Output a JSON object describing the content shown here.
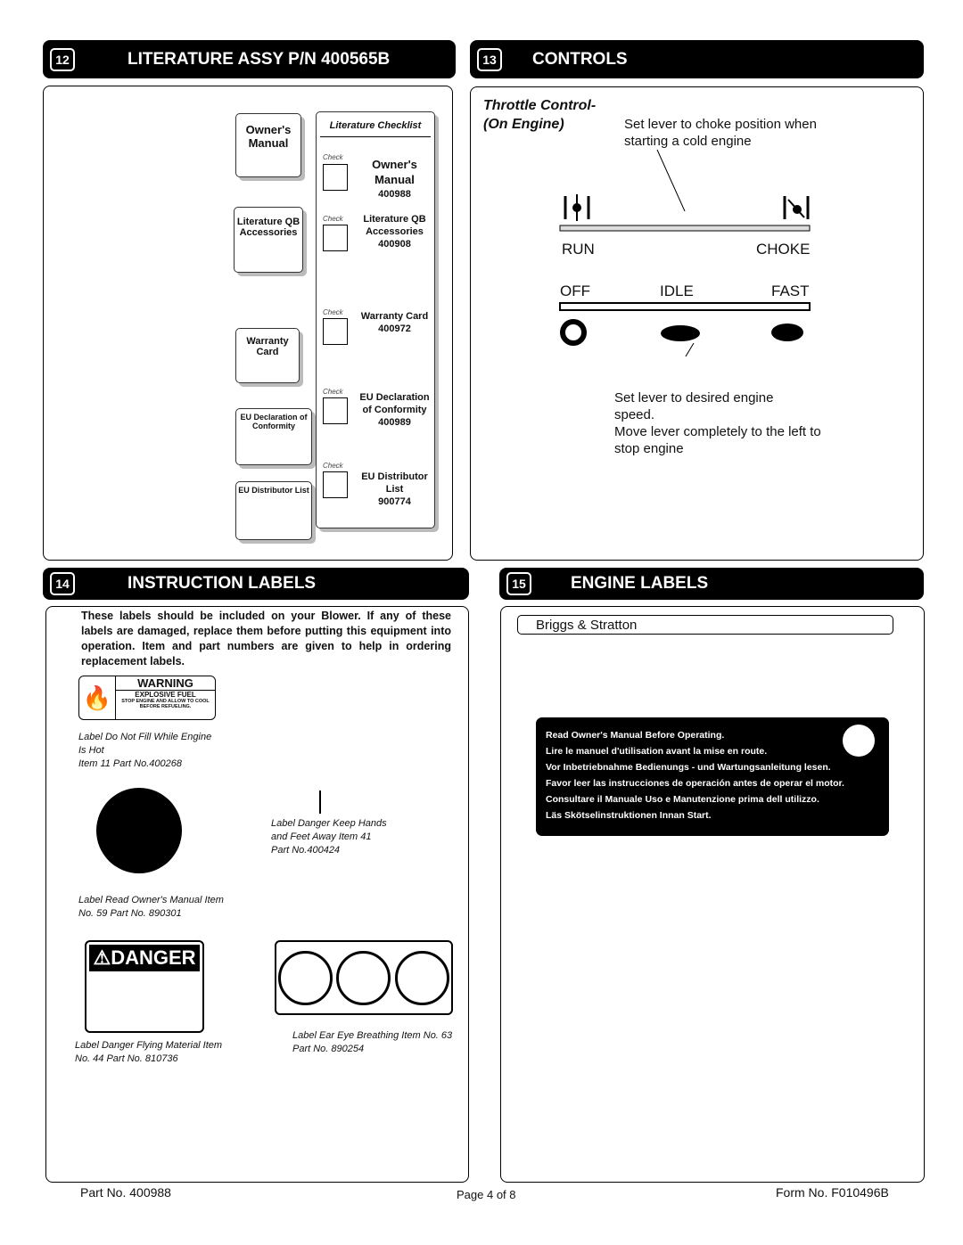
{
  "sections": {
    "s12": {
      "num": "12",
      "title": "LITERATURE ASSY  P/N  400565B"
    },
    "s13": {
      "num": "13",
      "title": "CONTROLS"
    },
    "s14": {
      "num": "14",
      "title": "INSTRUCTION  LABELS"
    },
    "s15": {
      "num": "15",
      "title": "ENGINE  LABELS"
    }
  },
  "literature": {
    "cards": [
      "Owner's Manual",
      "Literature QB Accessories",
      "Warranty Card",
      "EU Declaration of Conformity",
      "EU Distributor List"
    ],
    "checklist_title": "Literature Checklist",
    "check_label": "Check",
    "items": [
      {
        "name": "Owner's Manual",
        "part": "400988"
      },
      {
        "name": "Literature QB Accessories",
        "part": "400908"
      },
      {
        "name": "Warranty Card",
        "part": "400972"
      },
      {
        "name": "EU Declaration of Conformity",
        "part": "400989"
      },
      {
        "name": "EU Distributor List",
        "part": "900774"
      }
    ]
  },
  "controls": {
    "heading": "Throttle Control- (On Engine)",
    "choke_note": "Set lever to choke position when starting a cold engine",
    "run": "RUN",
    "choke": "CHOKE",
    "off": "OFF",
    "idle": "IDLE",
    "fast": "FAST",
    "speed_note": "Set lever to desired engine speed.",
    "stop_note": "Move lever completely to the left to stop engine"
  },
  "instructions": {
    "intro": "These labels should be included on your Blower.  If any of these labels are damaged, replace them before putting this equipment into operation. Item and part numbers are given to help in ordering replacement labels.",
    "warning": {
      "title": "WARNING",
      "sub": "EXPLOSIVE FUEL",
      "text": "STOP ENGINE AND ALLOW TO COOL BEFORE REFUELING.",
      "caption": "Label Do Not Fill While Engine Is Hot\nItem 11  Part No.400268"
    },
    "danger_keep_caption": "Label Danger Keep Hands and Feet Away Item 41 Part No.400424",
    "read_manual_caption": "Label Read Owner's Manual Item No. 59  Part No. 890301",
    "danger": {
      "title": "DANGER",
      "caption": "Label Danger Flying Material Item No. 44  Part No. 810736"
    },
    "ear_eye_caption": "Label Ear Eye Breathing Item No. 63 Part No. 890254"
  },
  "engine": {
    "field": "Briggs & Stratton",
    "label_lines": [
      "Read Owner's Manual Before Operating.",
      "Lire le manuel d'utilisation avant la mise en route.",
      "Vor Inbetriebnahme Bedienungs - und Wartungsanleitung lesen.",
      "Favor leer las instrucciones de operación antes de operar el motor.",
      "Consultare il Manuale Uso e Manutenzione prima dell utilizzo.",
      "Läs Skötselinstruktionen Innan Start."
    ]
  },
  "footer": {
    "part": "Part No. 400988",
    "page": "Page 4 of 8",
    "form": "Form No. F010496B"
  }
}
